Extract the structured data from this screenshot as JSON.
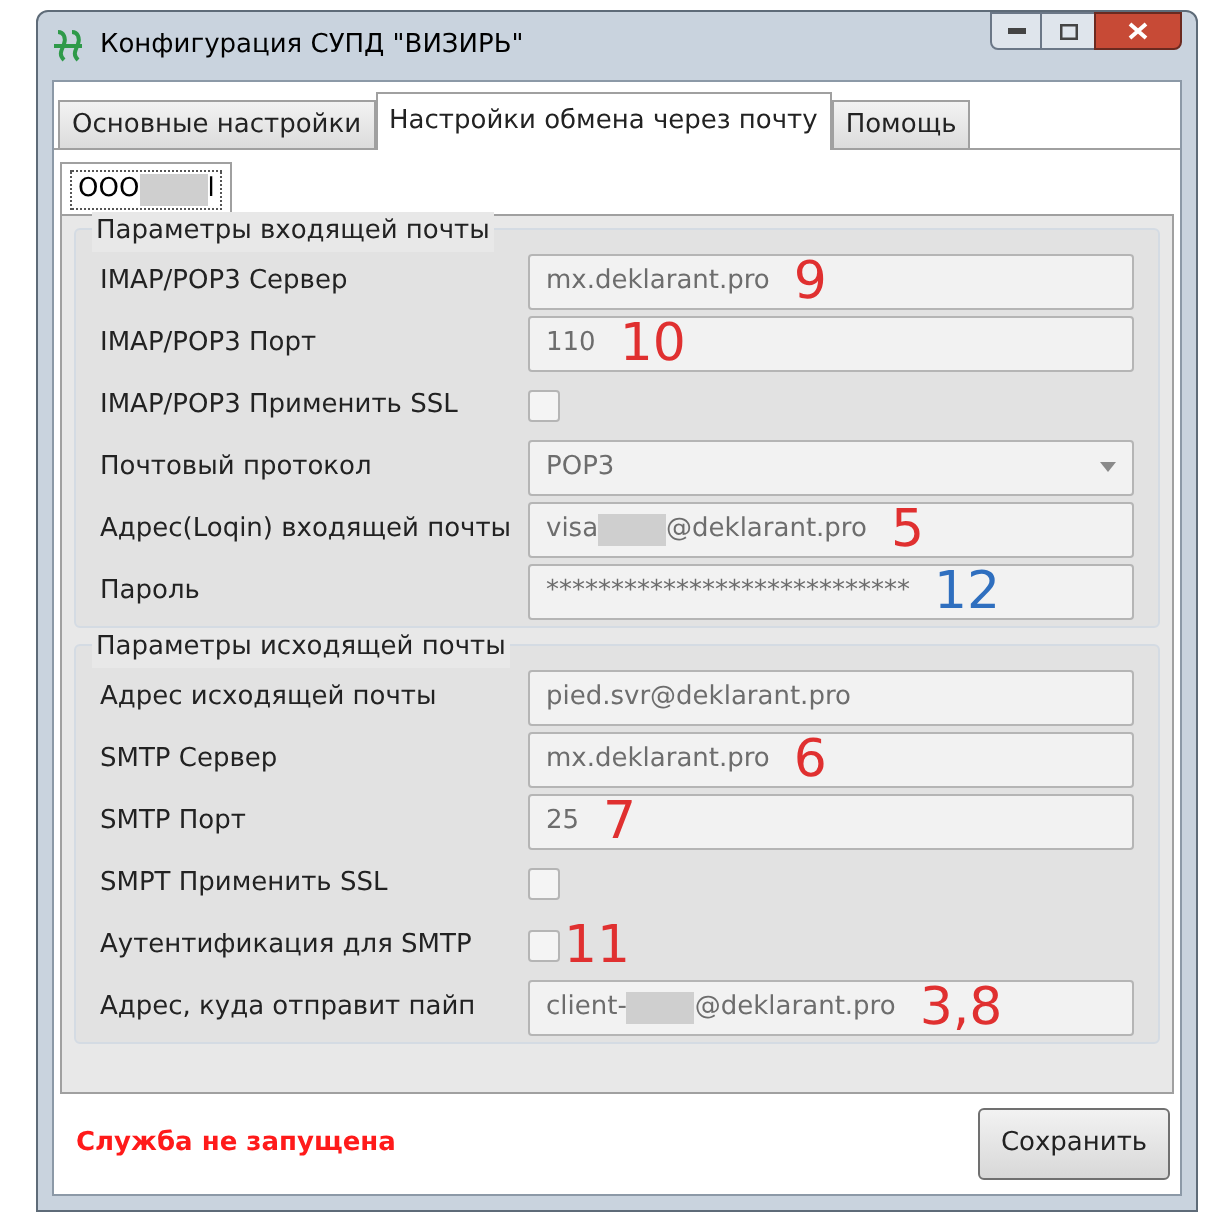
{
  "window": {
    "title": "Конфигурация СУПД \"ВИЗИРЬ\""
  },
  "tabs": [
    {
      "label": "Основные настройки",
      "selected": false
    },
    {
      "label": "Настройки обмена через почту",
      "selected": true
    },
    {
      "label": "Помощь",
      "selected": false
    }
  ],
  "subtab": {
    "parts": [
      {
        "kind": "text",
        "text": "ООО"
      },
      {
        "kind": "redacted"
      },
      {
        "kind": "text",
        "text": "l"
      }
    ],
    "selected": true
  },
  "groups": [
    {
      "title": "Параметры входящей почты",
      "rows": [
        {
          "kind": "text",
          "label": "IMAP/POP3 Сервер",
          "parts": [
            {
              "kind": "text",
              "text": "mx.deklarant.pro"
            }
          ],
          "annotation": "9",
          "color": "#e03030"
        },
        {
          "kind": "text",
          "label": "IMAP/POP3 Порт",
          "parts": [
            {
              "kind": "text",
              "text": "110"
            }
          ],
          "annotation": "10",
          "color": "#e03030"
        },
        {
          "kind": "checkbox",
          "label": "IMAP/POP3 Применить SSL",
          "checked": false
        },
        {
          "kind": "select",
          "label": "Почтовый протокол",
          "parts": [
            {
              "kind": "text",
              "text": "POP3"
            }
          ]
        },
        {
          "kind": "text",
          "label": "Адрес(Loqin) входящей почты",
          "parts": [
            {
              "kind": "text",
              "text": "visa"
            },
            {
              "kind": "redacted"
            },
            {
              "kind": "text",
              "text": "@deklarant.pro"
            }
          ],
          "annotation": "5",
          "color": "#e03030"
        },
        {
          "kind": "text",
          "label": "Пароль",
          "parts": [
            {
              "kind": "text",
              "text": "****************************"
            }
          ],
          "annotation": "12",
          "color": "#2f6fbf"
        }
      ]
    },
    {
      "title": "Параметры исходящей почты",
      "rows": [
        {
          "kind": "text",
          "label": "Адрес исходящей почты",
          "parts": [
            {
              "kind": "text",
              "text": "pied.svr@deklarant.pro"
            }
          ]
        },
        {
          "kind": "text",
          "label": "SMTP Сервер",
          "parts": [
            {
              "kind": "text",
              "text": "mx.deklarant.pro"
            }
          ],
          "annotation": "6",
          "color": "#e03030"
        },
        {
          "kind": "text",
          "label": "SMTP Порт",
          "parts": [
            {
              "kind": "text",
              "text": "25"
            }
          ],
          "annotation": "7",
          "color": "#e03030"
        },
        {
          "kind": "checkbox",
          "label": "SMPT Применить SSL",
          "checked": false
        },
        {
          "kind": "checkbox",
          "label": "Аутентификация для SMTP",
          "checked": false,
          "annotation": "11",
          "color": "#e03030"
        },
        {
          "kind": "text",
          "label": "Адрес, куда отправит пайп",
          "parts": [
            {
              "kind": "text",
              "text": "client-"
            },
            {
              "kind": "redacted"
            },
            {
              "kind": "text",
              "text": "@deklarant.pro"
            }
          ],
          "annotation": "3,8",
          "color": "#e03030"
        }
      ]
    }
  ],
  "status": "Служба не запущена",
  "save_button": "Сохранить"
}
